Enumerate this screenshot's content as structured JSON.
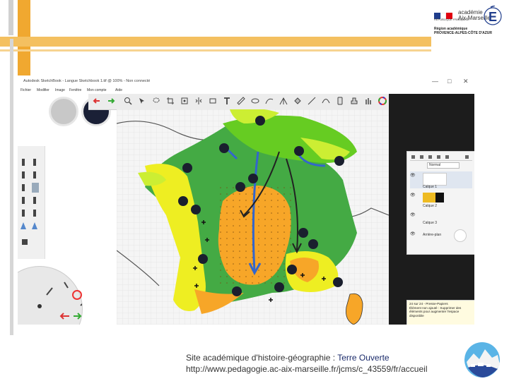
{
  "slide": {
    "footer_label": "Site académique d'histoire-géographie :",
    "footer_brand": "Terre Ouverte",
    "footer_url": "http://www.pedagogie.ac-aix-marseille.fr/jcms/c_43559/fr/accueil"
  },
  "logo": {
    "republic": "RÉPUBLIQUE FRANÇAISE",
    "academy_line1": "académie",
    "academy_line2": "Aix-Marseille",
    "region_line1": "Région académique",
    "region_line2": "PROVENCE-ALPES-CÔTE D'AZUR",
    "colors": {
      "blue": "#1f3d8c",
      "white": "#ffffff",
      "red": "#e1000f"
    }
  },
  "app": {
    "title": "Autodesk SketchBook - Langue Sketchbook 1.tif @ 100% - Non connecté",
    "window_controls": [
      "—",
      "□",
      "✕"
    ],
    "menu": [
      "Fichier",
      "Modifier",
      "Image",
      "Fenêtre",
      "Mon compte",
      "Aide"
    ]
  },
  "layers_panel": {
    "blend_mode": "Normal",
    "items": [
      "Calque 1",
      "Calque 2",
      "Calque 3",
      "Arrière-plan"
    ]
  },
  "tooltip": {
    "line1": "24 sur 24 - Presse-Papiers",
    "line2": "Élément non ajouté : Supprimer des",
    "line3": "éléments pour augmenter l'espace",
    "line4": "disponible"
  },
  "map_colors": {
    "bright_green": "#66cc22",
    "yellow_green": "#ccee33",
    "dark_green": "#44aa44",
    "mid_green": "#55bb55",
    "orange": "#f7a628",
    "yellow": "#eeee22",
    "blue_arrow": "#3366cc",
    "black_dot": "#1a1f2e"
  }
}
